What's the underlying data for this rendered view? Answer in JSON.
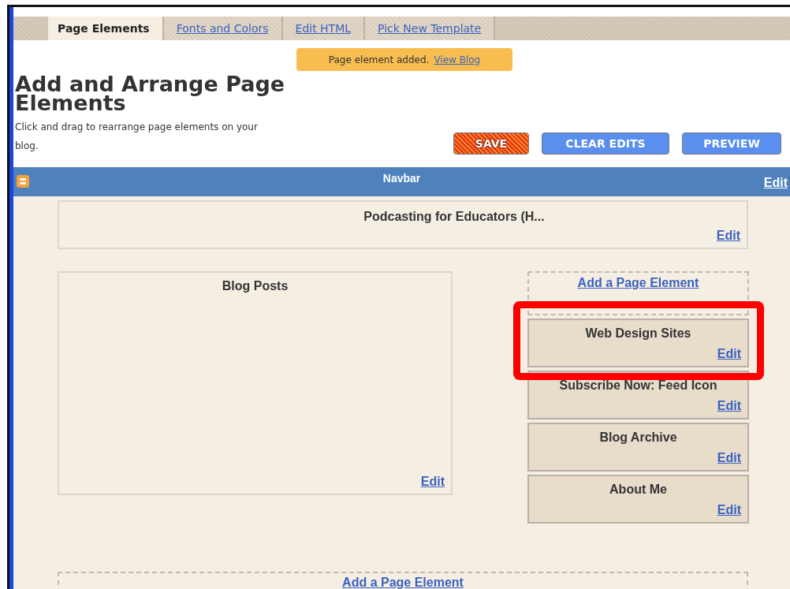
{
  "tabs": [
    {
      "label": "Page Elements",
      "selected": true
    },
    {
      "label": "Fonts and Colors",
      "selected": false
    },
    {
      "label": "Edit HTML",
      "selected": false
    },
    {
      "label": "Pick New Template",
      "selected": false
    }
  ],
  "notice": {
    "text": "Page element added.",
    "link": "View Blog"
  },
  "heading": {
    "title": "Add and Arrange Page Elements",
    "subtitle": "Click and drag to rearrange page elements on your blog."
  },
  "buttons": [
    {
      "label": "SAVE",
      "kind": "save"
    },
    {
      "label": "CLEAR EDITS",
      "kind": "normal"
    },
    {
      "label": "PREVIEW",
      "kind": "normal"
    }
  ],
  "navbar": {
    "title": "Navbar",
    "edit": "Edit"
  },
  "header_widget": {
    "title": "Podcasting for Educators (H...",
    "edit": "Edit"
  },
  "main_widget": {
    "title": "Blog Posts",
    "edit": "Edit"
  },
  "sidebar": {
    "add_link": "Add a Page Element",
    "widgets": [
      {
        "title": "Web Design Sites",
        "edit": "Edit",
        "highlighted": true
      },
      {
        "title": "Subscribe Now: Feed Icon",
        "edit": "Edit",
        "highlighted": false
      },
      {
        "title": "Blog Archive",
        "edit": "Edit",
        "highlighted": false
      },
      {
        "title": "About Me",
        "edit": "Edit",
        "highlighted": false
      }
    ]
  },
  "footer_add_link": "Add a Page Element"
}
